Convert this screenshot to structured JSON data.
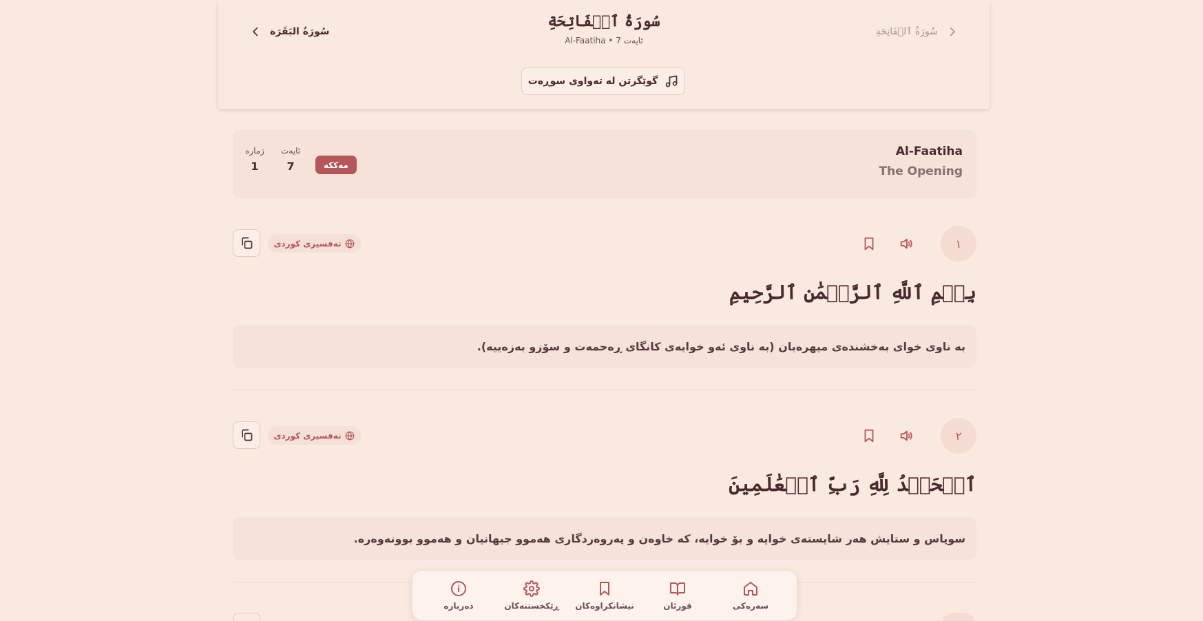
{
  "header": {
    "title": "سُورَةُ ٱلۡفَاتِحَةِ",
    "subtitle": "Al-Faatiha • 7 ئایەت",
    "next_surah": "سُورَةُ البَقَرَة",
    "prev_surah": "سُورَةُ ٱلۡفَاتِحَةِ",
    "listen_label": "گوێگرتن لە تەواوی سوڕەت"
  },
  "info": {
    "name_en": "Al-Faatiha",
    "name_translation": "The Opening",
    "revelation_badge": "مەککە",
    "ayah_label": "ئایەت",
    "ayah_count": "7",
    "number_label": "ژمارە",
    "number": "1"
  },
  "verses": [
    {
      "number": "١",
      "arabic": "بِسۡمِ ٱللَّهِ ٱلرَّحۡمَٰنِ ٱلرَّحِيمِ",
      "translation": "بە ناوی خوای بەخشندەی میهرەبان (بە ناوی ئەو خوایەی کانگای ڕەحمەت و سۆزو بەزەییە).",
      "tafsir_label": "تەفسیری کوردی"
    },
    {
      "number": "٢",
      "arabic": "ٱلۡحَمۡدُ لِلَّهِ رَبِّ ٱلۡعَٰلَمِينَ",
      "translation": "سوپاس و ستایش هەر شایستەی خوایە و بۆ خوایە، کە خاوەن و پەروەردگاری هەموو جیهانیان و هەموو بوونەوەرە.",
      "tafsir_label": "تەفسیری کوردی"
    }
  ],
  "bottom_nav": {
    "home": "سەرەکی",
    "quran": "قورئان",
    "bookmarks": "نیشانکراوەکان",
    "settings": "ڕێکخستنەکان",
    "about": "دەربارە"
  },
  "colors": {
    "background": "#f9e9df",
    "accent": "#b5565a",
    "text": "#4a2a2e",
    "card": "#f5e2d8"
  }
}
